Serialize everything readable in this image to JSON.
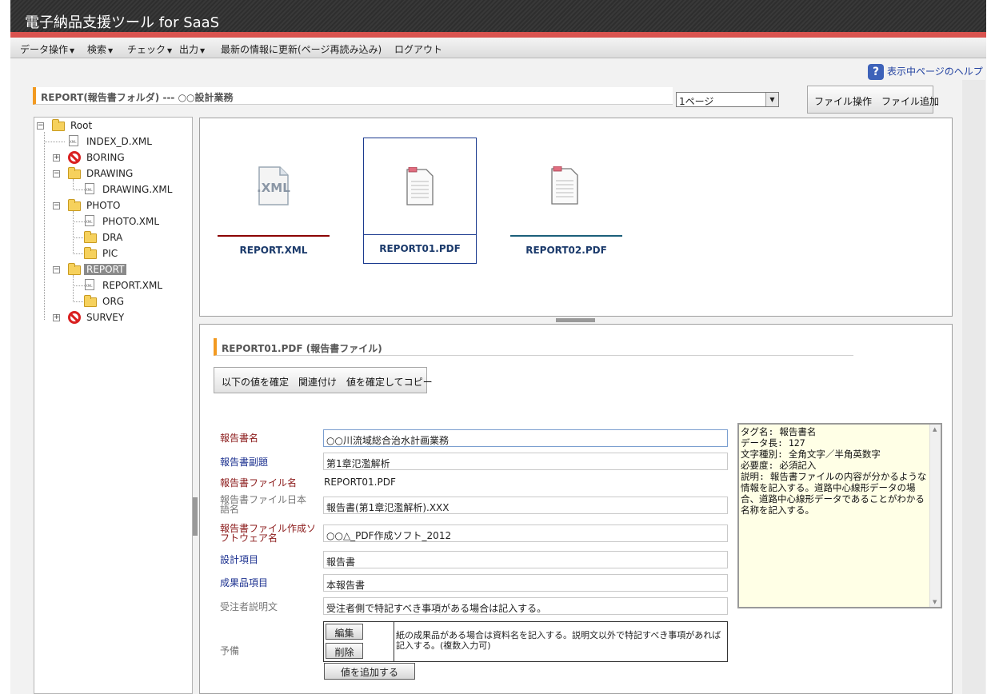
{
  "app": {
    "title": "電子納品支援ツール for SaaS"
  },
  "menu": {
    "data_ops": "データ操作",
    "search": "検索",
    "check": "チェック",
    "output": "出力",
    "refresh": "最新の情報に更新(ページ再読み込み)",
    "logout": "ログアウト"
  },
  "help": {
    "label": "表示中ページのヘルプ",
    "icon": "question-icon"
  },
  "folder_header": "REPORT(報告書フォルダ) --- ○○設計業務",
  "page_select": {
    "value": "1ページ"
  },
  "file_ops_button": "ファイル操作　ファイル追加",
  "tree": {
    "root": "Root",
    "index_xml": "INDEX_D.XML",
    "boring": "BORING",
    "drawing": "DRAWING",
    "drawing_xml": "DRAWING.XML",
    "photo": "PHOTO",
    "photo_xml": "PHOTO.XML",
    "dra": "DRA",
    "pic": "PIC",
    "report": "REPORT",
    "report_xml": "REPORT.XML",
    "org": "ORG",
    "survey": "SURVEY"
  },
  "files": [
    {
      "name": "REPORT.XML",
      "icon": "xml-file-icon"
    },
    {
      "name": "REPORT01.PDF",
      "icon": "document-icon"
    },
    {
      "name": "REPORT02.PDF",
      "icon": "document-icon"
    }
  ],
  "detail": {
    "header": "REPORT01.PDF  (報告書ファイル)",
    "confirm_button": "以下の値を確定　関連付け　値を確定してコピー"
  },
  "form": {
    "report_name": {
      "label": "報告書名",
      "value": "○○川流域総合治水計画業務"
    },
    "report_subtitle": {
      "label": "報告書副題",
      "value": "第1章氾濫解析"
    },
    "report_file_name": {
      "label": "報告書ファイル名",
      "value": "REPORT01.PDF"
    },
    "report_file_jp": {
      "label": "報告書ファイル日本語名",
      "value": "報告書(第1章氾濫解析).XXX"
    },
    "report_software": {
      "label": "報告書ファイル作成ソフトウェア名",
      "value": "○○△_PDF作成ソフト_2012"
    },
    "design_item": {
      "label": "設計項目",
      "value": "報告書"
    },
    "deliverable_item": {
      "label": "成果品項目",
      "value": "本報告書"
    },
    "contractor_desc": {
      "label": "受注者説明文",
      "value": "受注者側で特記すべき事項がある場合は記入する。"
    },
    "reserve": {
      "label": "予備",
      "edit": "編集",
      "delete": "削除",
      "note": "紙の成果品がある場合は資料名を記入する。説明文以外で特記すべき事項があれば記入する。(複数入力可)",
      "add": "値を追加する"
    }
  },
  "info_text": "タグ名: 報告書名\nデータ長: 127\n文字種別: 全角文字／半角英数字\n必要度: 必須記入\n説明: 報告書ファイルの内容が分かるような情報を記入する。道路中心線形データの場合、道路中心線形データであることがわかる名称を記入する。",
  "colors": {
    "accent": "#f29a21",
    "title_bg": "#2e2e2e",
    "red_bar": "#d9534f",
    "required_label": "#8b1a1a",
    "link_label": "#1a2f8f"
  }
}
